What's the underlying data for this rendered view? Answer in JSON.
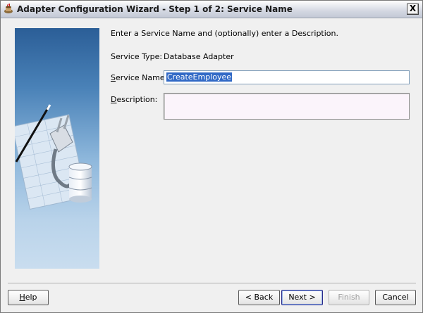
{
  "window": {
    "title": "Adapter Configuration Wizard - Step 1 of 2: Service Name",
    "close_label": "X"
  },
  "form": {
    "intro": "Enter a Service Name and (optionally) enter a Description.",
    "service_type_label": "Service Type:",
    "service_type_value": "Database Adapter",
    "service_name_label": "Service Name:",
    "service_name_value": "CreateEmployee",
    "description_label": "Description:",
    "description_value": ""
  },
  "buttons": {
    "help": "Help",
    "back": "< Back",
    "next": "Next >",
    "finish": "Finish",
    "cancel": "Cancel"
  },
  "colors": {
    "selection": "#3169c6",
    "panel_blue": "#2c5f98",
    "description_bg": "#fbf4fb"
  }
}
